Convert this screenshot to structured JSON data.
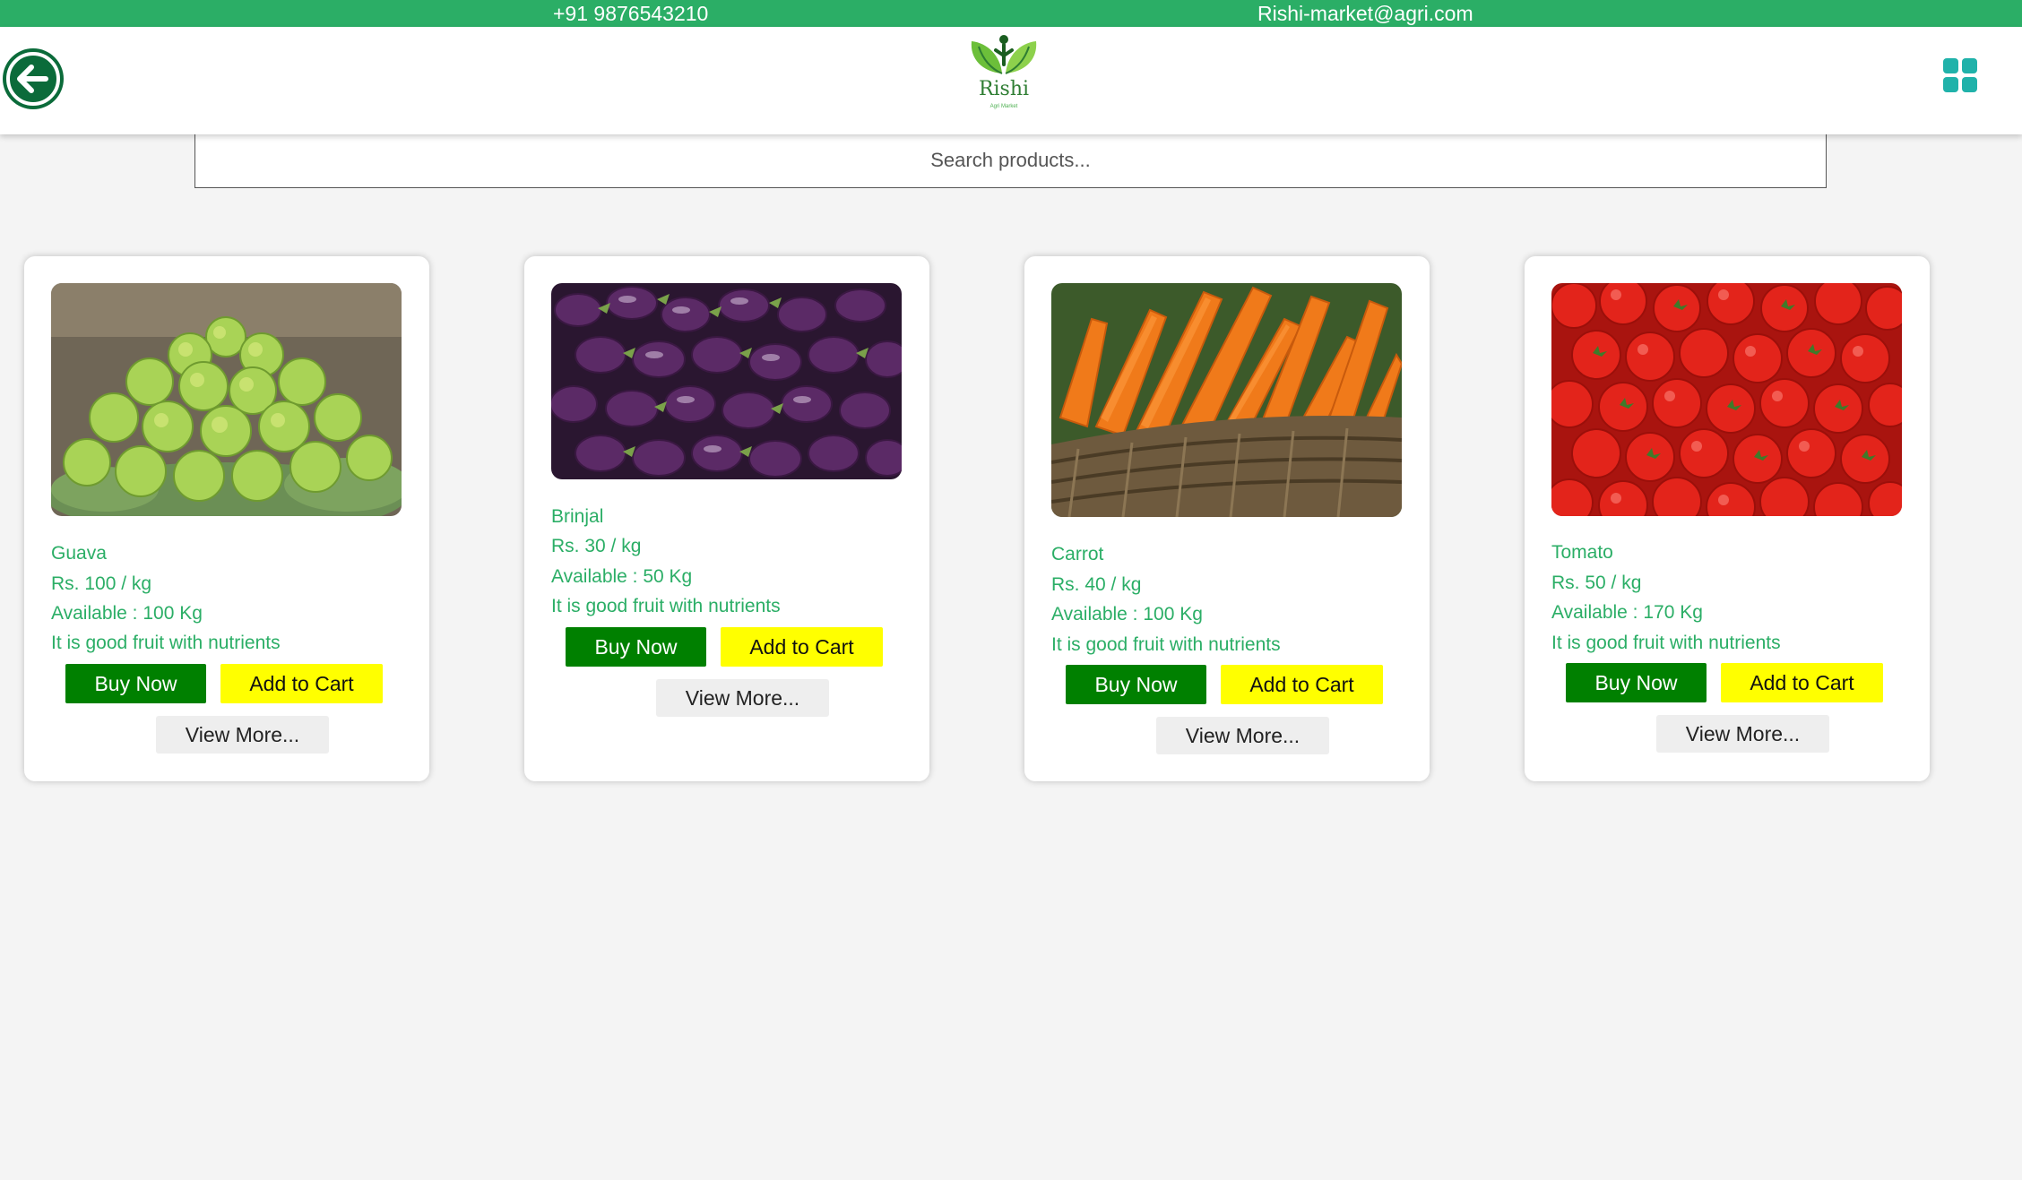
{
  "topbar": {
    "phone": "+91 9876543210",
    "email": "Rishi-market@agri.com"
  },
  "header": {
    "brand": "Rishi",
    "tagline": "Agri Market"
  },
  "search": {
    "placeholder": "Search products..."
  },
  "products": [
    {
      "name": "Guava",
      "price": "Rs. 100 / kg",
      "available": "Available : 100 Kg",
      "description": "It is good fruit with nutrients",
      "buy_label": "Buy Now",
      "cart_label": "Add to Cart",
      "more_label": "View More..."
    },
    {
      "name": "Brinjal",
      "price": "Rs. 30 / kg",
      "available": "Available : 50 Kg",
      "description": "It is good fruit with nutrients",
      "buy_label": "Buy Now",
      "cart_label": "Add to Cart",
      "more_label": "View More..."
    },
    {
      "name": "Carrot",
      "price": "Rs. 40 / kg",
      "available": "Available : 100 Kg",
      "description": "It is good fruit with nutrients",
      "buy_label": "Buy Now",
      "cart_label": "Add to Cart",
      "more_label": "View More..."
    },
    {
      "name": "Tomato",
      "price": "Rs. 50 / kg",
      "available": "Available : 170 Kg",
      "description": "It is good fruit with nutrients",
      "buy_label": "Buy Now",
      "cart_label": "Add to Cart",
      "more_label": "View More..."
    }
  ],
  "colors": {
    "topbar": "#2bae66",
    "product_text": "#2bae66",
    "buy_button": "#008000",
    "cart_button": "#ffff00",
    "back_button": "#0b6b3a",
    "menu_icon": "#20b2aa"
  },
  "icons": {
    "back": "arrow-left-circle-icon",
    "menu": "grid-icon",
    "logo": "leaf-person-logo"
  }
}
